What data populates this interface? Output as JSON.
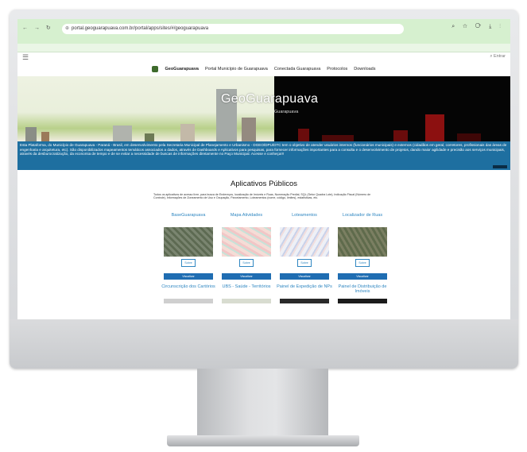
{
  "browser": {
    "nav_icons": "← → ↻",
    "site_icon": "⊕",
    "url": "portal.geoguarapuava.com.br/portal/apps/sites/#/geoguarapuava",
    "right_icons": "⌕ ☆ ⟳ ⤓ ⋮"
  },
  "topbar": {
    "menu_icon": "☰",
    "search_icon": "⌕",
    "search_label": "Entrar"
  },
  "nav": {
    "brand": "GeoGuarapuava",
    "items": [
      "Portal Município de Guarapuava",
      "Conectada Guarapuava",
      "Protocolos",
      "Downloads"
    ]
  },
  "hero": {
    "title": "GeoGuarapuava",
    "subtitle": "Guarapuava"
  },
  "info": {
    "text": "Esta Plataforma, do Município de Guarapuava - Paraná - Brasil, em desenvolvimento pela Secretaria Municipal de Planejamento e Urbanismo - DGEO/DPU/DTC tem o objetivo de atender usuários internos (funcionários municipais) e externos (cidadãos em geral, corretores, profissionais das áreas de engenharia e arquitetura, etc). São disponibilizados mapeamentos temáticos associados a dados, através de Dashboards e Aplicativos para pesquisas, para fornecer informações importantes para a consulta e o desenvolvimento de projetos, dando maior agilidade e precisão aos serviços municipais, através da desburocratização, da economia de tempo e de se evitar a necessidade de buscas de informações diretamente no Paço Municipal. Acesse e conheça!!!"
  },
  "apps": {
    "heading": "Aplicativos Públicos",
    "description": "Todos os aplicativos de acesso livre, para busca de Endereços, localização de Imóveis e Ruas, Numeração Predial, SQL (Setor Quadra Lote), Indicação Fiscal (Número de Controle), informações de Zoneamento de Uso e Ocupação, Parcelamento, Loteamentos (nome, código, limites), estatísticas, etc.",
    "sobre_label": "Sobre",
    "visualizar_label": "Visualizar",
    "cards": [
      {
        "title": "BaseGuarapuava",
        "color": "#6f7a62"
      },
      {
        "title": "Mapa Atividades",
        "color": "#f2d7d2"
      },
      {
        "title": "Loteamentos",
        "color": "#e6e9f2"
      },
      {
        "title": "Localizador de Ruas",
        "color": "#5e6a4a"
      }
    ],
    "cards_row2": [
      {
        "title": "Circunscrição dos Cartórios",
        "color": "#cfcfcf"
      },
      {
        "title": "UBS - Saúde - Territórios",
        "color": "#d8dcd0"
      },
      {
        "title": "Painel de Expedição de NPs",
        "color": "#2a2a2a"
      },
      {
        "title": "Painel de Distribuição de Imóveis",
        "color": "#1b1b1b"
      }
    ]
  }
}
